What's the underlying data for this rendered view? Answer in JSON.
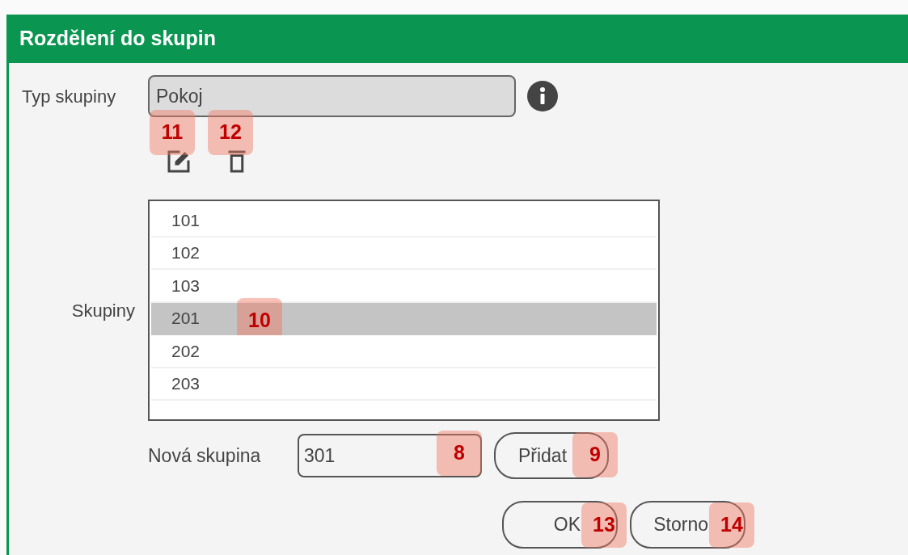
{
  "window": {
    "title": "Rozdělení do skupin"
  },
  "group_type": {
    "label": "Typ skupiny",
    "value": "Pokoj"
  },
  "toolbar": [
    {
      "kind": "edit",
      "callout": "11"
    },
    {
      "kind": "delete",
      "callout": "12"
    }
  ],
  "groups": {
    "label": "Skupiny",
    "items": [
      {
        "text": "101",
        "selected": false
      },
      {
        "text": "102",
        "selected": false
      },
      {
        "text": "103",
        "selected": false
      },
      {
        "text": "201",
        "selected": true,
        "callout": "10"
      },
      {
        "text": "202",
        "selected": false
      },
      {
        "text": "203",
        "selected": false
      }
    ]
  },
  "new_group": {
    "label": "Nová skupina",
    "value": "301",
    "callout": "8"
  },
  "add_button": {
    "label": "Přidat",
    "callout": "9"
  },
  "buttons": [
    {
      "label": "OK",
      "callout": "13"
    },
    {
      "label": "Storno",
      "callout": "14"
    }
  ]
}
